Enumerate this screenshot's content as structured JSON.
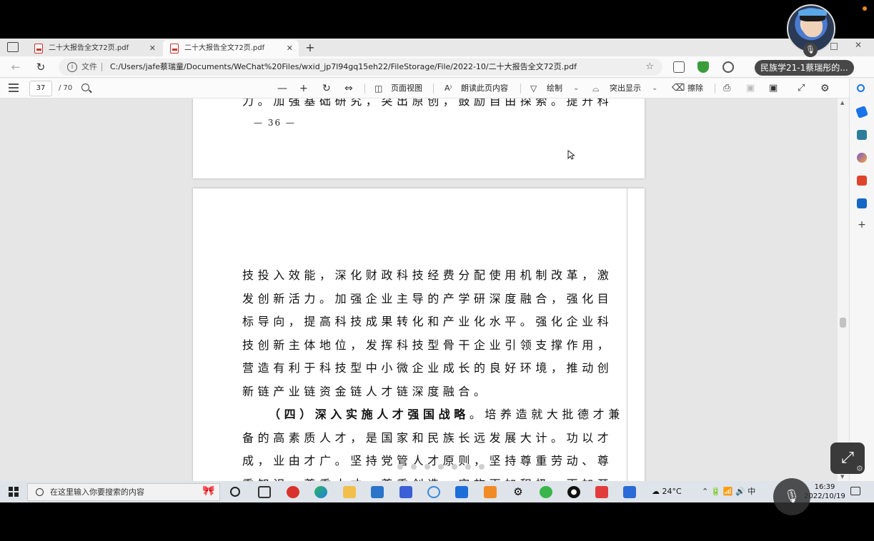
{
  "call": {
    "participant_name": "民族学21-1蔡瑞彤的..."
  },
  "browser": {
    "tabs": [
      {
        "label": "二十大报告全文72页.pdf",
        "active": false
      },
      {
        "label": "二十大报告全文72页.pdf",
        "active": true
      }
    ],
    "address": {
      "scheme_label": "文件",
      "url": "C:/Users/jafe蔡瑞童/Documents/WeChat%20Files/wxid_jp7l94gq15eh22/FileStorage/File/2022-10/二十大报告全文72页.pdf"
    }
  },
  "pdf_toolbar": {
    "current_page": "37",
    "total_pages": "/ 70",
    "page_view_label": "页面视图",
    "read_aloud_label": "朗读此页内容",
    "draw_label": "绘制",
    "highlight_label": "突出显示",
    "erase_label": "擦除"
  },
  "document": {
    "prev_page_last_line": "力。加强基础研究，突出原创，鼓励自由探索。提升科",
    "prev_page_number": "— 36 —",
    "lines": [
      "技投入效能，深化财政科技经费分配使用机制改革，激",
      "发创新活力。加强企业主导的产学研深度融合，强化目",
      "标导向，提高科技成果转化和产业化水平。强化企业科",
      "技创新主体地位，发挥科技型骨干企业引领支撑作用，",
      "营造有利于科技型中小微企业成长的良好环境，推动创",
      "新链产业链资金链人才链深度融合。"
    ],
    "section_heading": "（四）深入实施人才强国战略",
    "section_lines": [
      "。培养造就大批德才兼",
      "备的高素质人才，是国家和民族长远发展大计。功以才",
      "成，业由才广。坚持党管人才原则，坚持尊重劳动、尊",
      "重知识、尊重人才、尊重创造，实施更加积极、更加开"
    ]
  },
  "taskbar": {
    "search_placeholder": "在这里输入你要搜索的内容",
    "weather": "24°C",
    "ime": "中",
    "time": "16:39",
    "date": "2022/10/19"
  },
  "colors": {
    "pdf_icon": "#c6352e",
    "taskbar_bg": "#dfe4ea",
    "viewport_bg": "#e6e6e6"
  }
}
